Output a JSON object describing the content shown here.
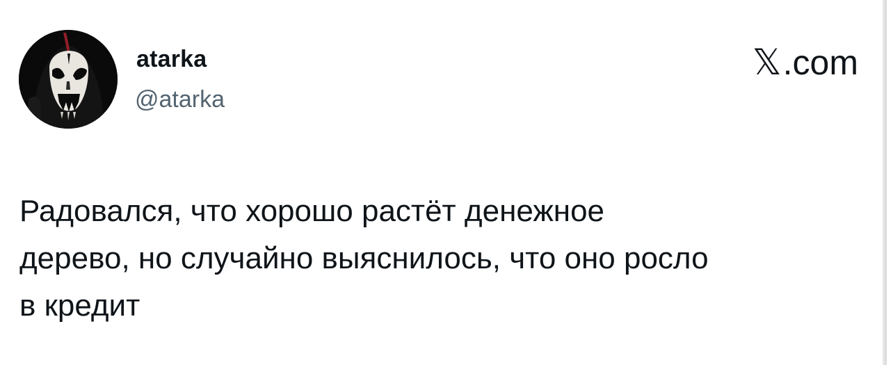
{
  "author": {
    "display_name": "atarka",
    "handle": "@atarka",
    "avatar_icon": "black-metal-face-avatar"
  },
  "brand": {
    "x_glyph": "𝕏",
    "suffix": ".com",
    "icon": "x-logo-icon"
  },
  "tweet": {
    "text": "Радовался, что хорошо растёт денежное\nдерево, но случайно выяснилось, что оно росло\nв кредит"
  },
  "colors": {
    "text_primary": "#0f1419",
    "text_secondary": "#536471",
    "background": "#ffffff"
  }
}
